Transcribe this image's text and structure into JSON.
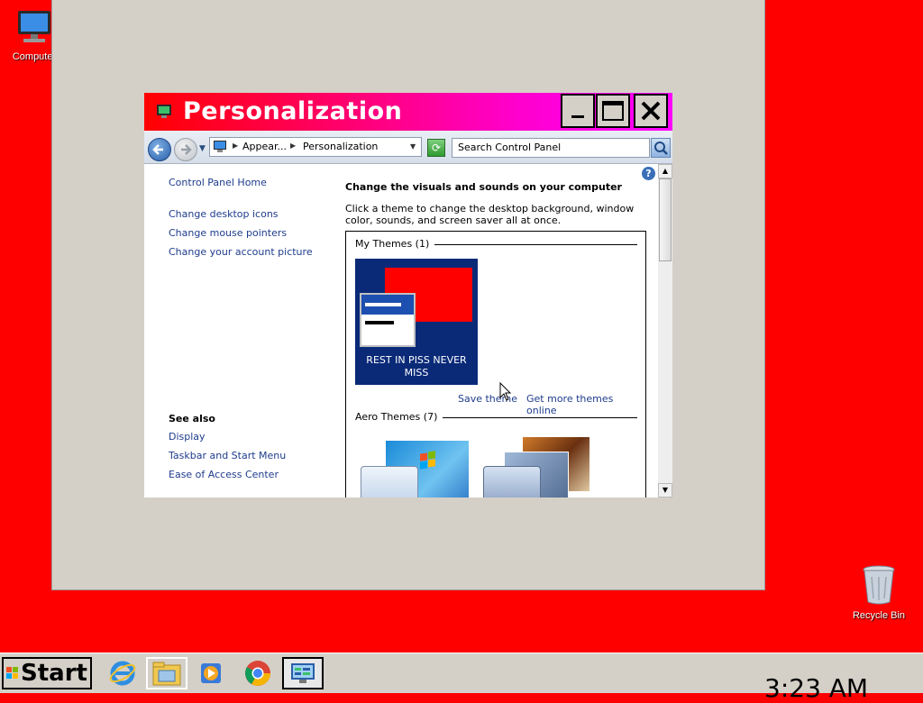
{
  "desktop": {
    "background_color": "#ff0000",
    "icons": {
      "computer": {
        "label": "Computer",
        "icon": "computer-icon"
      },
      "recycle_bin": {
        "label": "Recycle Bin",
        "icon": "recycle-bin-icon"
      }
    }
  },
  "window": {
    "title": "Personalization",
    "title_gradient": [
      "#ff0000",
      "#ff00ff"
    ],
    "controls": {
      "minimize": "minimize-icon",
      "maximize": "maximize-icon",
      "close": "close-icon"
    },
    "address": {
      "crumbs": [
        "Appear...",
        "Personalization"
      ],
      "search_placeholder": "Search Control Panel"
    },
    "left_pane": {
      "home_link": "Control Panel Home",
      "links": [
        "Change desktop icons",
        "Change mouse pointers",
        "Change your account picture"
      ],
      "see_also_title": "See also",
      "see_also_links": [
        "Display",
        "Taskbar and Start Menu",
        "Ease of Access Center"
      ]
    },
    "main": {
      "heading": "Change the visuals and sounds on your computer",
      "description": "Click a theme to change the desktop background, window color, sounds, and screen saver all at once.",
      "my_themes_title": "My Themes (1)",
      "my_theme_name": "REST IN PISS NEVER MISS",
      "save_theme": "Save theme",
      "get_more": "Get more themes online",
      "aero_themes_title": "Aero Themes (7)"
    }
  },
  "taskbar": {
    "start_label": "Start",
    "apps": [
      "internet-explorer-icon",
      "windows-explorer-icon",
      "media-player-icon",
      "chrome-icon",
      "control-panel-icon"
    ],
    "clock": "3:23 AM"
  }
}
